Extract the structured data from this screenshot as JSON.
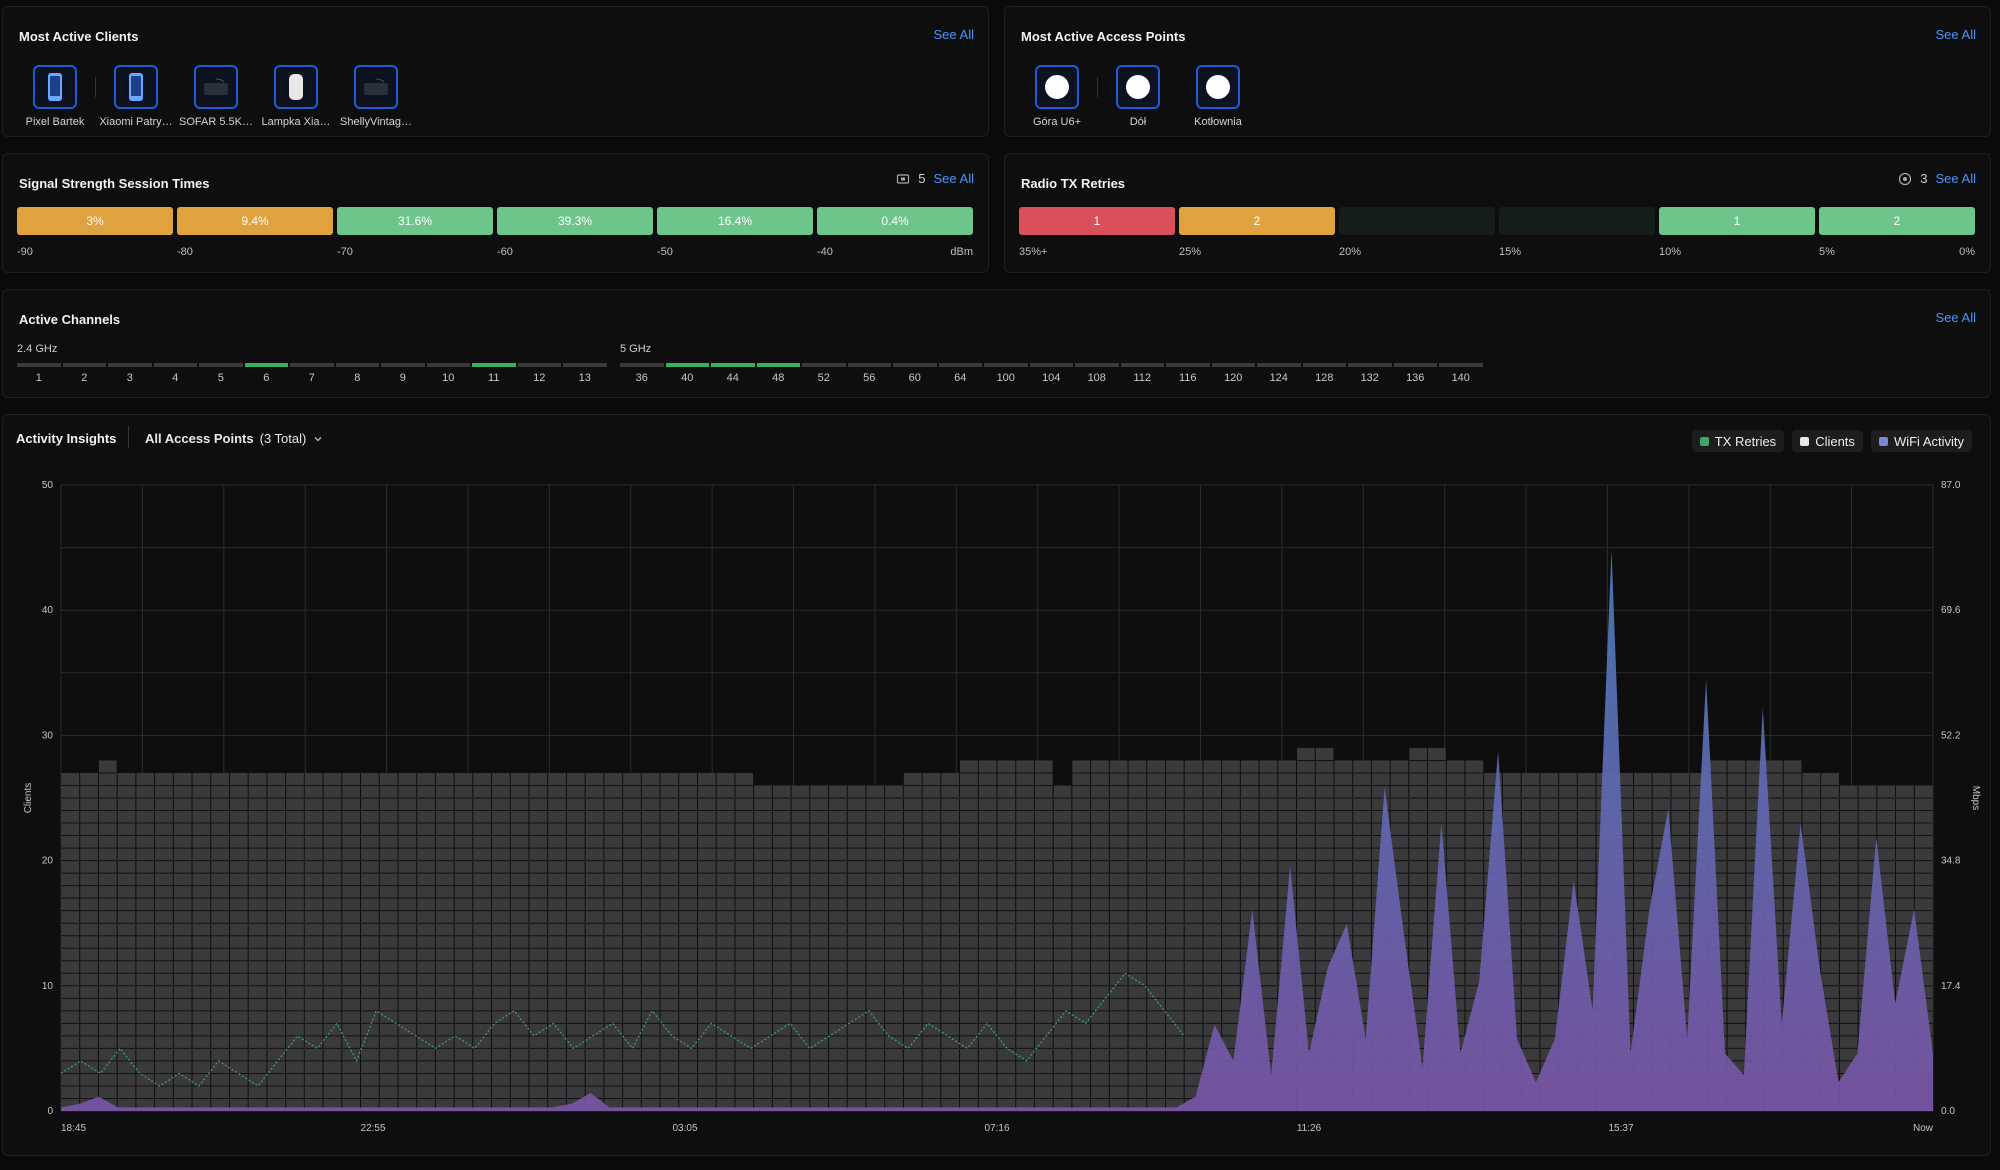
{
  "clients": {
    "title": "Most Active Clients",
    "see_all": "See All",
    "items": [
      {
        "label": "Pixel Bartek",
        "icon": "phone-icon"
      },
      {
        "label": "Xiaomi Patry…",
        "icon": "phone-icon"
      },
      {
        "label": "SOFAR 5.5K…",
        "icon": "iot-device-icon"
      },
      {
        "label": "Lampka Xia…",
        "icon": "lamp-icon"
      },
      {
        "label": "ShellyVintag…",
        "icon": "iot-device-icon"
      }
    ]
  },
  "access_points": {
    "title": "Most Active Access Points",
    "see_all": "See All",
    "items": [
      {
        "label": "Góra U6+",
        "icon": "access-point-icon"
      },
      {
        "label": "Dół",
        "icon": "access-point-icon"
      },
      {
        "label": "Kotłownia",
        "icon": "access-point-icon"
      }
    ]
  },
  "signal": {
    "title": "Signal Strength Session Times",
    "count": "5",
    "see_all": "See All",
    "segments": [
      {
        "label": "3%",
        "color": "#e0a23f"
      },
      {
        "label": "9.4%",
        "color": "#e0a23f"
      },
      {
        "label": "31.6%",
        "color": "#6dc58b"
      },
      {
        "label": "39.3%",
        "color": "#6dc58b"
      },
      {
        "label": "16.4%",
        "color": "#6dc58b"
      },
      {
        "label": "0.4%",
        "color": "#6dc58b"
      }
    ],
    "scale": [
      "-90",
      "-80",
      "-70",
      "-60",
      "-50",
      "-40",
      "dBm"
    ]
  },
  "tx_retries": {
    "title": "Radio TX Retries",
    "count": "3",
    "see_all": "See All",
    "segments": [
      {
        "label": "1",
        "color": "#d8505a"
      },
      {
        "label": "2",
        "color": "#e0a23f"
      },
      {
        "label": "",
        "color": "#151d18"
      },
      {
        "label": "",
        "color": "#151d18"
      },
      {
        "label": "1",
        "color": "#6dc58b"
      },
      {
        "label": "2",
        "color": "#6dc58b"
      }
    ],
    "scale": [
      "35%+",
      "25%",
      "20%",
      "15%",
      "10%",
      "5%",
      "0%"
    ]
  },
  "channels": {
    "title": "Active Channels",
    "see_all": "See All",
    "band_24": {
      "label": "2.4 GHz",
      "channels": [
        "1",
        "2",
        "3",
        "4",
        "5",
        "6",
        "7",
        "8",
        "9",
        "10",
        "11",
        "12",
        "13"
      ],
      "active": [
        "6",
        "11"
      ]
    },
    "band_5": {
      "label": "5 GHz",
      "channels": [
        "36",
        "40",
        "44",
        "48",
        "52",
        "56",
        "60",
        "64",
        "100",
        "104",
        "108",
        "112",
        "116",
        "120",
        "124",
        "128",
        "132",
        "136",
        "140"
      ],
      "active": [
        "40",
        "44",
        "48"
      ]
    }
  },
  "activity": {
    "title": "Activity Insights",
    "select_label": "All Access Points",
    "select_count": "(3 Total)",
    "legend": [
      {
        "label": "TX Retries",
        "color": "#3fa664"
      },
      {
        "label": "Clients",
        "color": "#e8e8e8"
      },
      {
        "label": "WiFi Activity",
        "color": "#7b86d9"
      }
    ]
  },
  "chart_data": {
    "type": "bar",
    "ylabel": "Clients",
    "y2label": "Mbps",
    "ylim": [
      0,
      50
    ],
    "y2lim": [
      0,
      87.0
    ],
    "yticks": [
      "0",
      "10",
      "20",
      "30",
      "40",
      "50"
    ],
    "y2ticks": [
      "0.0",
      "17.4",
      "34.8",
      "52.2",
      "69.6",
      "87.0"
    ],
    "xticks": [
      "18:45",
      "22:55",
      "03:05",
      "07:16",
      "11:26",
      "15:37",
      "Now"
    ],
    "grid": true,
    "series": [
      {
        "name": "Clients",
        "values": [
          27,
          27,
          28,
          27,
          27,
          27,
          27,
          27,
          27,
          27,
          27,
          27,
          27,
          27,
          27,
          27,
          27,
          27,
          27,
          27,
          27,
          27,
          27,
          27,
          27,
          27,
          27,
          27,
          27,
          27,
          27,
          27,
          27,
          27,
          27,
          27,
          27,
          26,
          26,
          26,
          26,
          26,
          26,
          26,
          26,
          27,
          27,
          27,
          28,
          28,
          28,
          28,
          28,
          26,
          28,
          28,
          28,
          28,
          28,
          28,
          28,
          28,
          28,
          28,
          28,
          28,
          29,
          29,
          28,
          28,
          28,
          28,
          29,
          29,
          28,
          28,
          27,
          27,
          27,
          27,
          27,
          27,
          27,
          27,
          27,
          27,
          27,
          27,
          28,
          28,
          28,
          28,
          28,
          27,
          27,
          26,
          26,
          26,
          26,
          26
        ]
      },
      {
        "name": "WiFi Activity",
        "values": [
          0.5,
          1.0,
          2.0,
          0.5,
          0.5,
          0.5,
          0.5,
          0.5,
          0.5,
          0.5,
          0.5,
          0.5,
          0.5,
          0.5,
          0.5,
          0.5,
          0.5,
          0.5,
          0.5,
          0.5,
          0.5,
          0.5,
          0.5,
          0.5,
          0.5,
          0.5,
          0.5,
          1.0,
          2.5,
          0.5,
          0.5,
          0.5,
          0.5,
          0.5,
          0.5,
          0.5,
          0.5,
          0.5,
          0.5,
          0.5,
          0.5,
          0.5,
          0.5,
          0.5,
          0.5,
          0.5,
          0.5,
          0.5,
          0.5,
          0.5,
          0.5,
          0.5,
          0.5,
          0.5,
          0.5,
          0.5,
          0.5,
          0.5,
          0.5,
          0.5,
          2.0,
          12,
          7,
          28,
          5,
          34,
          8,
          20,
          26,
          10,
          45,
          25,
          6,
          40,
          8,
          18,
          50,
          10,
          4,
          10,
          32,
          14,
          78,
          8,
          28,
          42,
          10,
          60,
          8,
          5,
          56,
          12,
          40,
          20,
          4,
          8,
          38,
          15,
          28,
          8
        ]
      },
      {
        "name": "TX Retries",
        "values": [
          3,
          4,
          3,
          5,
          3,
          2,
          3,
          2,
          4,
          3,
          2,
          4,
          6,
          5,
          7,
          4,
          8,
          7,
          6,
          5,
          6,
          5,
          7,
          8,
          6,
          7,
          5,
          6,
          7,
          5,
          8,
          6,
          5,
          7,
          6,
          5,
          6,
          7,
          5,
          6,
          7,
          8,
          6,
          5,
          7,
          6,
          5,
          7,
          5,
          4,
          6,
          8,
          7,
          9,
          11,
          10,
          8,
          6
        ]
      }
    ]
  }
}
